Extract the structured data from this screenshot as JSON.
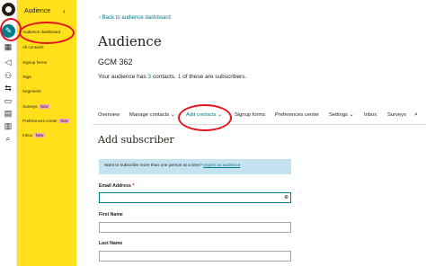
{
  "rail": {
    "icons": [
      "mailchimp-logo-icon",
      "pencil-icon",
      "grid-icon",
      "megaphone-icon",
      "audience-icon",
      "automation-icon",
      "website-icon",
      "content-icon",
      "analytics-icon",
      "search-icon"
    ]
  },
  "sidebar": {
    "title": "Audience",
    "collapse_icon": "chevron-left-icon",
    "items": [
      {
        "label": "Audience dashboard"
      },
      {
        "label": "All contacts"
      },
      {
        "label": "Signup forms"
      },
      {
        "label": "Tags"
      },
      {
        "label": "Segments"
      },
      {
        "label": "Surveys",
        "badge": "New"
      },
      {
        "label": "Preferences center",
        "badge": "New"
      },
      {
        "label": "Inbox",
        "badge": "New"
      }
    ]
  },
  "main": {
    "back_link": "Back to audience dashboard",
    "title": "Audience",
    "audience_name": "GCM 362",
    "summary": {
      "prefix": "Your audience has ",
      "count": "3",
      "middle": " contacts. ",
      "subscribers": "1",
      "suffix": " of these are subscribers."
    },
    "tabs": [
      {
        "label": "Overview"
      },
      {
        "label": "Manage contacts",
        "dropdown": true
      },
      {
        "label": "Add contacts",
        "dropdown": true,
        "active": true
      },
      {
        "label": "Signup forms"
      },
      {
        "label": "Preferences center"
      },
      {
        "label": "Settings",
        "dropdown": true
      },
      {
        "label": "Inbox"
      },
      {
        "label": "Surveys"
      }
    ],
    "dropdown_glyph": "⌄",
    "form_title": "Add subscriber",
    "banner": {
      "text": "Want to subscribe more than one person at a time? ",
      "link": "Import an audience"
    },
    "fields": {
      "email_label": "Email Address",
      "required_mark": "*",
      "email_value": "",
      "first_name_label": "First Name",
      "first_name_value": "",
      "last_name_label": "Last Name",
      "last_name_value": ""
    }
  },
  "colors": {
    "accent": "#007c89",
    "sidebar": "#ffe01b",
    "annotation": "#e8141c",
    "badge": "#f5a4c8",
    "banner": "#c5e2f0"
  }
}
